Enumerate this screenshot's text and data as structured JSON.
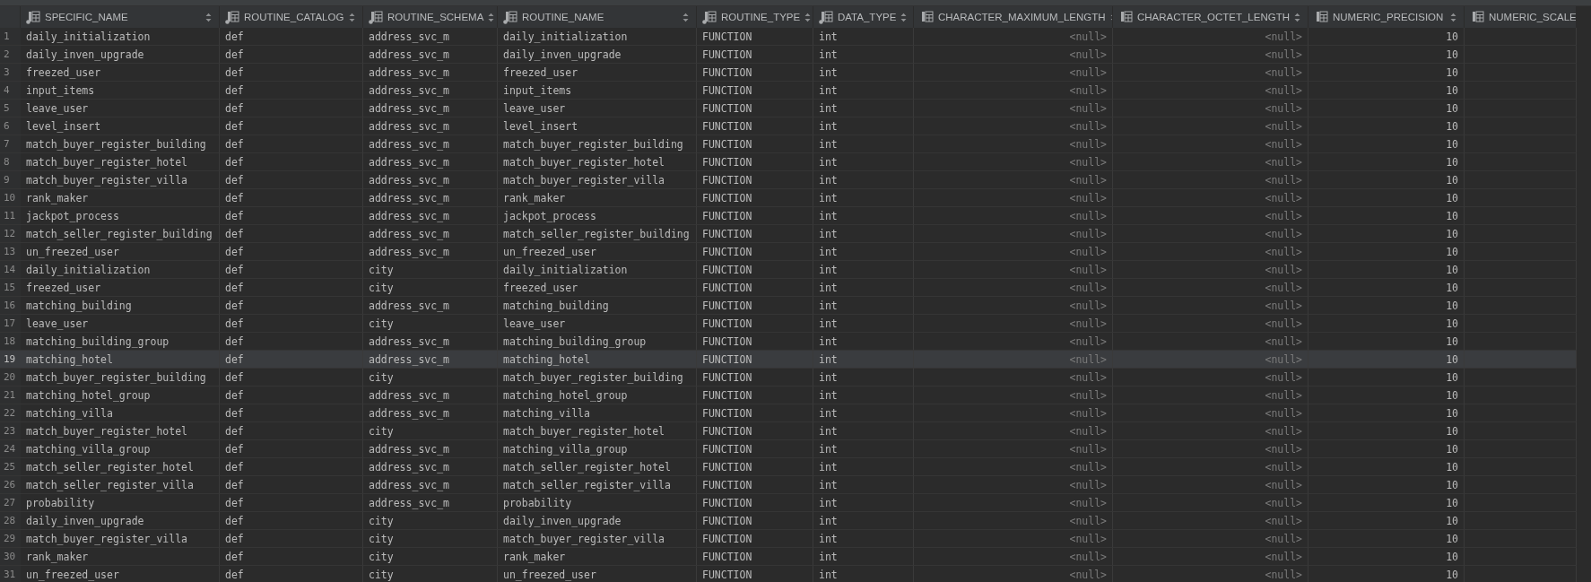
{
  "table": {
    "columns": [
      {
        "label": "SPECIFIC_NAME",
        "kind": "text",
        "indexed": true
      },
      {
        "label": "ROUTINE_CATALOG",
        "kind": "text",
        "indexed": true
      },
      {
        "label": "ROUTINE_SCHEMA",
        "kind": "text",
        "indexed": true
      },
      {
        "label": "ROUTINE_NAME",
        "kind": "text",
        "indexed": true
      },
      {
        "label": "ROUTINE_TYPE",
        "kind": "text",
        "indexed": true
      },
      {
        "label": "DATA_TYPE",
        "kind": "text",
        "indexed": true
      },
      {
        "label": "CHARACTER_MAXIMUM_LENGTH",
        "kind": "null",
        "indexed": false
      },
      {
        "label": "CHARACTER_OCTET_LENGTH",
        "kind": "null",
        "indexed": false
      },
      {
        "label": "NUMERIC_PRECISION",
        "kind": "number",
        "indexed": false
      },
      {
        "label": "NUMERIC_SCALE",
        "kind": "number",
        "indexed": false
      }
    ],
    "rows": [
      {
        "num": "1",
        "selected": false,
        "cells": [
          "daily_initialization",
          "def",
          "address_svc_m",
          "daily_initialization",
          "FUNCTION",
          "int",
          "<null>",
          "<null>",
          "10"
        ]
      },
      {
        "num": "2",
        "selected": false,
        "cells": [
          "daily_inven_upgrade",
          "def",
          "address_svc_m",
          "daily_inven_upgrade",
          "FUNCTION",
          "int",
          "<null>",
          "<null>",
          "10"
        ]
      },
      {
        "num": "3",
        "selected": false,
        "cells": [
          "freezed_user",
          "def",
          "address_svc_m",
          "freezed_user",
          "FUNCTION",
          "int",
          "<null>",
          "<null>",
          "10"
        ]
      },
      {
        "num": "4",
        "selected": false,
        "cells": [
          "input_items",
          "def",
          "address_svc_m",
          "input_items",
          "FUNCTION",
          "int",
          "<null>",
          "<null>",
          "10"
        ]
      },
      {
        "num": "5",
        "selected": false,
        "cells": [
          "leave_user",
          "def",
          "address_svc_m",
          "leave_user",
          "FUNCTION",
          "int",
          "<null>",
          "<null>",
          "10"
        ]
      },
      {
        "num": "6",
        "selected": false,
        "cells": [
          "level_insert",
          "def",
          "address_svc_m",
          "level_insert",
          "FUNCTION",
          "int",
          "<null>",
          "<null>",
          "10"
        ]
      },
      {
        "num": "7",
        "selected": false,
        "cells": [
          "match_buyer_register_building",
          "def",
          "address_svc_m",
          "match_buyer_register_building",
          "FUNCTION",
          "int",
          "<null>",
          "<null>",
          "10"
        ]
      },
      {
        "num": "8",
        "selected": false,
        "cells": [
          "match_buyer_register_hotel",
          "def",
          "address_svc_m",
          "match_buyer_register_hotel",
          "FUNCTION",
          "int",
          "<null>",
          "<null>",
          "10"
        ]
      },
      {
        "num": "9",
        "selected": false,
        "cells": [
          "match_buyer_register_villa",
          "def",
          "address_svc_m",
          "match_buyer_register_villa",
          "FUNCTION",
          "int",
          "<null>",
          "<null>",
          "10"
        ]
      },
      {
        "num": "10",
        "selected": false,
        "cells": [
          "rank_maker",
          "def",
          "address_svc_m",
          "rank_maker",
          "FUNCTION",
          "int",
          "<null>",
          "<null>",
          "10"
        ]
      },
      {
        "num": "11",
        "selected": false,
        "cells": [
          "jackpot_process",
          "def",
          "address_svc_m",
          "jackpot_process",
          "FUNCTION",
          "int",
          "<null>",
          "<null>",
          "10"
        ]
      },
      {
        "num": "12",
        "selected": false,
        "cells": [
          "match_seller_register_building",
          "def",
          "address_svc_m",
          "match_seller_register_building",
          "FUNCTION",
          "int",
          "<null>",
          "<null>",
          "10"
        ]
      },
      {
        "num": "13",
        "selected": false,
        "cells": [
          "un_freezed_user",
          "def",
          "address_svc_m",
          "un_freezed_user",
          "FUNCTION",
          "int",
          "<null>",
          "<null>",
          "10"
        ]
      },
      {
        "num": "14",
        "selected": false,
        "cells": [
          "daily_initialization",
          "def",
          "city",
          "daily_initialization",
          "FUNCTION",
          "int",
          "<null>",
          "<null>",
          "10"
        ]
      },
      {
        "num": "15",
        "selected": false,
        "cells": [
          "freezed_user",
          "def",
          "city",
          "freezed_user",
          "FUNCTION",
          "int",
          "<null>",
          "<null>",
          "10"
        ]
      },
      {
        "num": "16",
        "selected": false,
        "cells": [
          "matching_building",
          "def",
          "address_svc_m",
          "matching_building",
          "FUNCTION",
          "int",
          "<null>",
          "<null>",
          "10"
        ]
      },
      {
        "num": "17",
        "selected": false,
        "cells": [
          "leave_user",
          "def",
          "city",
          "leave_user",
          "FUNCTION",
          "int",
          "<null>",
          "<null>",
          "10"
        ]
      },
      {
        "num": "18",
        "selected": false,
        "cells": [
          "matching_building_group",
          "def",
          "address_svc_m",
          "matching_building_group",
          "FUNCTION",
          "int",
          "<null>",
          "<null>",
          "10"
        ]
      },
      {
        "num": "19",
        "selected": true,
        "cells": [
          "matching_hotel",
          "def",
          "address_svc_m",
          "matching_hotel",
          "FUNCTION",
          "int",
          "<null>",
          "<null>",
          "10"
        ]
      },
      {
        "num": "20",
        "selected": false,
        "cells": [
          "match_buyer_register_building",
          "def",
          "city",
          "match_buyer_register_building",
          "FUNCTION",
          "int",
          "<null>",
          "<null>",
          "10"
        ]
      },
      {
        "num": "21",
        "selected": false,
        "cells": [
          "matching_hotel_group",
          "def",
          "address_svc_m",
          "matching_hotel_group",
          "FUNCTION",
          "int",
          "<null>",
          "<null>",
          "10"
        ]
      },
      {
        "num": "22",
        "selected": false,
        "cells": [
          "matching_villa",
          "def",
          "address_svc_m",
          "matching_villa",
          "FUNCTION",
          "int",
          "<null>",
          "<null>",
          "10"
        ]
      },
      {
        "num": "23",
        "selected": false,
        "cells": [
          "match_buyer_register_hotel",
          "def",
          "city",
          "match_buyer_register_hotel",
          "FUNCTION",
          "int",
          "<null>",
          "<null>",
          "10"
        ]
      },
      {
        "num": "24",
        "selected": false,
        "cells": [
          "matching_villa_group",
          "def",
          "address_svc_m",
          "matching_villa_group",
          "FUNCTION",
          "int",
          "<null>",
          "<null>",
          "10"
        ]
      },
      {
        "num": "25",
        "selected": false,
        "cells": [
          "match_seller_register_hotel",
          "def",
          "address_svc_m",
          "match_seller_register_hotel",
          "FUNCTION",
          "int",
          "<null>",
          "<null>",
          "10"
        ]
      },
      {
        "num": "26",
        "selected": false,
        "cells": [
          "match_seller_register_villa",
          "def",
          "address_svc_m",
          "match_seller_register_villa",
          "FUNCTION",
          "int",
          "<null>",
          "<null>",
          "10"
        ]
      },
      {
        "num": "27",
        "selected": false,
        "cells": [
          "probability",
          "def",
          "address_svc_m",
          "probability",
          "FUNCTION",
          "int",
          "<null>",
          "<null>",
          "10"
        ]
      },
      {
        "num": "28",
        "selected": false,
        "cells": [
          "daily_inven_upgrade",
          "def",
          "city",
          "daily_inven_upgrade",
          "FUNCTION",
          "int",
          "<null>",
          "<null>",
          "10"
        ]
      },
      {
        "num": "29",
        "selected": false,
        "cells": [
          "match_buyer_register_villa",
          "def",
          "city",
          "match_buyer_register_villa",
          "FUNCTION",
          "int",
          "<null>",
          "<null>",
          "10"
        ]
      },
      {
        "num": "30",
        "selected": false,
        "cells": [
          "rank_maker",
          "def",
          "city",
          "rank_maker",
          "FUNCTION",
          "int",
          "<null>",
          "<null>",
          "10"
        ]
      },
      {
        "num": "31",
        "selected": false,
        "cells": [
          "un_freezed_user",
          "def",
          "city",
          "un_freezed_user",
          "FUNCTION",
          "int",
          "<null>",
          "<null>",
          "10"
        ]
      }
    ]
  }
}
